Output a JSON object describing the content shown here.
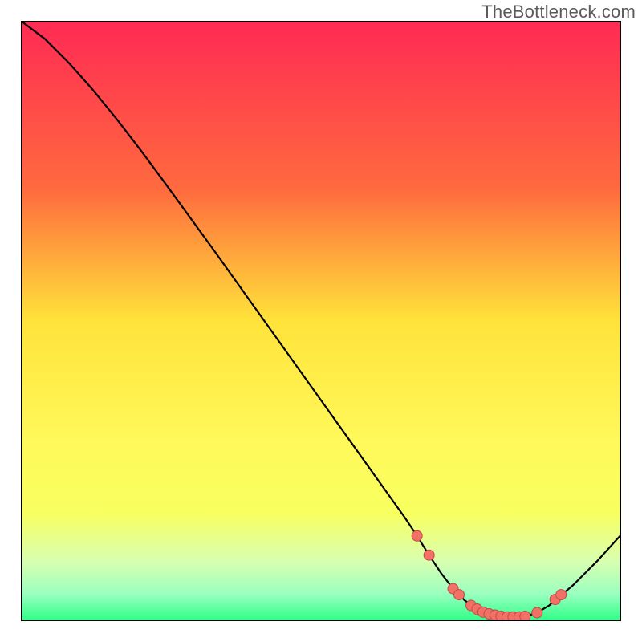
{
  "attribution": "TheBottleneck.com",
  "colors": {
    "gradient_top": "#ff2a54",
    "gradient_upper_mid": "#ff8a3a",
    "gradient_mid": "#ffe33a",
    "gradient_lower_mid": "#f8ff60",
    "gradient_near_bottom": "#d8ffb0",
    "gradient_bottom": "#2bff86",
    "curve": "#000000",
    "dot_fill": "#f27066",
    "dot_stroke": "#bd4e45",
    "border": "#000000"
  },
  "chart_data": {
    "type": "line",
    "title": "",
    "xlabel": "",
    "ylabel": "",
    "xlim": [
      0,
      100
    ],
    "ylim": [
      0,
      100
    ],
    "grid": false,
    "legend": false,
    "x": [
      0,
      4,
      8,
      12,
      16,
      20,
      24,
      28,
      32,
      36,
      40,
      44,
      48,
      52,
      56,
      60,
      64,
      66,
      68,
      70,
      72,
      74,
      76,
      78,
      80,
      82,
      84,
      86,
      88,
      92,
      96,
      100
    ],
    "values": [
      100,
      97.0,
      93.0,
      88.5,
      83.6,
      78.4,
      73.0,
      67.5,
      62.0,
      56.4,
      50.8,
      45.2,
      39.6,
      34.0,
      28.4,
      22.8,
      17.2,
      14.2,
      11.0,
      8.0,
      5.4,
      3.4,
      2.0,
      1.2,
      0.8,
      0.7,
      0.8,
      1.4,
      2.6,
      6.0,
      10.0,
      14.4
    ],
    "dots": [
      {
        "x": 66,
        "y": 14.2
      },
      {
        "x": 68,
        "y": 11.0
      },
      {
        "x": 72,
        "y": 5.4
      },
      {
        "x": 73,
        "y": 4.4
      },
      {
        "x": 75,
        "y": 2.6
      },
      {
        "x": 76,
        "y": 2.0
      },
      {
        "x": 77,
        "y": 1.5
      },
      {
        "x": 78,
        "y": 1.2
      },
      {
        "x": 79,
        "y": 1.0
      },
      {
        "x": 80,
        "y": 0.8
      },
      {
        "x": 81,
        "y": 0.7
      },
      {
        "x": 82,
        "y": 0.7
      },
      {
        "x": 83,
        "y": 0.7
      },
      {
        "x": 84,
        "y": 0.8
      },
      {
        "x": 86,
        "y": 1.4
      },
      {
        "x": 89,
        "y": 3.6
      },
      {
        "x": 90,
        "y": 4.4
      }
    ]
  }
}
